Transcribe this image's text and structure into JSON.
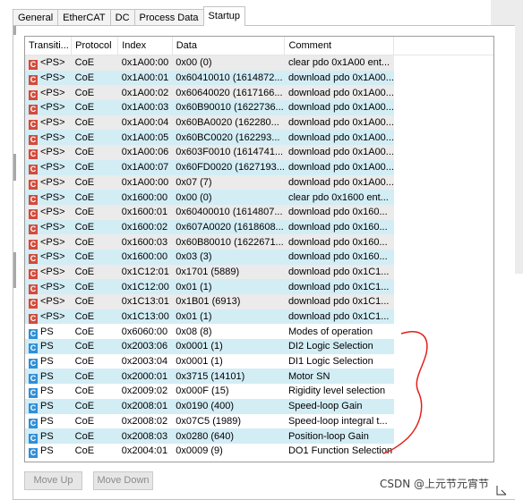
{
  "tabs": [
    {
      "label": "General",
      "active": false
    },
    {
      "label": "EtherCAT",
      "active": false
    },
    {
      "label": "DC",
      "active": false
    },
    {
      "label": "Process Data",
      "active": false
    },
    {
      "label": "Startup",
      "active": true
    }
  ],
  "columns": [
    "Transiti...",
    "Protocol",
    "Index",
    "Data",
    "Comment"
  ],
  "rows": [
    {
      "icon": "C",
      "icon_color": "red",
      "transition": "<PS>",
      "protocol": "CoE",
      "index": "0x1A00:00",
      "data": "0x00 (0)",
      "comment": "clear pdo 0x1A00 ent..."
    },
    {
      "icon": "C",
      "icon_color": "red",
      "transition": "<PS>",
      "protocol": "CoE",
      "index": "0x1A00:01",
      "data": "0x60410010 (1614872...",
      "comment": "download pdo 0x1A00..."
    },
    {
      "icon": "C",
      "icon_color": "red",
      "transition": "<PS>",
      "protocol": "CoE",
      "index": "0x1A00:02",
      "data": "0x60640020 (1617166...",
      "comment": "download pdo 0x1A00..."
    },
    {
      "icon": "C",
      "icon_color": "red",
      "transition": "<PS>",
      "protocol": "CoE",
      "index": "0x1A00:03",
      "data": "0x60B90010 (1622736...",
      "comment": "download pdo 0x1A00..."
    },
    {
      "icon": "C",
      "icon_color": "red",
      "transition": "<PS>",
      "protocol": "CoE",
      "index": "0x1A00:04",
      "data": "0x60BA0020 (162280...",
      "comment": "download pdo 0x1A00..."
    },
    {
      "icon": "C",
      "icon_color": "red",
      "transition": "<PS>",
      "protocol": "CoE",
      "index": "0x1A00:05",
      "data": "0x60BC0020 (162293...",
      "comment": "download pdo 0x1A00..."
    },
    {
      "icon": "C",
      "icon_color": "red",
      "transition": "<PS>",
      "protocol": "CoE",
      "index": "0x1A00:06",
      "data": "0x603F0010 (1614741...",
      "comment": "download pdo 0x1A00..."
    },
    {
      "icon": "C",
      "icon_color": "red",
      "transition": "<PS>",
      "protocol": "CoE",
      "index": "0x1A00:07",
      "data": "0x60FD0020 (1627193...",
      "comment": "download pdo 0x1A00..."
    },
    {
      "icon": "C",
      "icon_color": "red",
      "transition": "<PS>",
      "protocol": "CoE",
      "index": "0x1A00:00",
      "data": "0x07 (7)",
      "comment": "download pdo 0x1A00..."
    },
    {
      "icon": "C",
      "icon_color": "red",
      "transition": "<PS>",
      "protocol": "CoE",
      "index": "0x1600:00",
      "data": "0x00 (0)",
      "comment": "clear pdo 0x1600 ent..."
    },
    {
      "icon": "C",
      "icon_color": "red",
      "transition": "<PS>",
      "protocol": "CoE",
      "index": "0x1600:01",
      "data": "0x60400010 (1614807...",
      "comment": "download pdo 0x160..."
    },
    {
      "icon": "C",
      "icon_color": "red",
      "transition": "<PS>",
      "protocol": "CoE",
      "index": "0x1600:02",
      "data": "0x607A0020 (1618608...",
      "comment": "download pdo 0x160..."
    },
    {
      "icon": "C",
      "icon_color": "red",
      "transition": "<PS>",
      "protocol": "CoE",
      "index": "0x1600:03",
      "data": "0x60B80010 (1622671...",
      "comment": "download pdo 0x160..."
    },
    {
      "icon": "C",
      "icon_color": "red",
      "transition": "<PS>",
      "protocol": "CoE",
      "index": "0x1600:00",
      "data": "0x03 (3)",
      "comment": "download pdo 0x160..."
    },
    {
      "icon": "C",
      "icon_color": "red",
      "transition": "<PS>",
      "protocol": "CoE",
      "index": "0x1C12:01",
      "data": "0x1701 (5889)",
      "comment": "download pdo 0x1C1..."
    },
    {
      "icon": "C",
      "icon_color": "red",
      "transition": "<PS>",
      "protocol": "CoE",
      "index": "0x1C12:00",
      "data": "0x01 (1)",
      "comment": "download pdo 0x1C1..."
    },
    {
      "icon": "C",
      "icon_color": "red",
      "transition": "<PS>",
      "protocol": "CoE",
      "index": "0x1C13:01",
      "data": "0x1B01 (6913)",
      "comment": "download pdo 0x1C1..."
    },
    {
      "icon": "C",
      "icon_color": "red",
      "transition": "<PS>",
      "protocol": "CoE",
      "index": "0x1C13:00",
      "data": "0x01 (1)",
      "comment": "download pdo 0x1C1..."
    },
    {
      "icon": "C",
      "icon_color": "blue",
      "transition": "PS",
      "protocol": "CoE",
      "index": "0x6060:00",
      "data": "0x08 (8)",
      "comment": "Modes of operation"
    },
    {
      "icon": "C",
      "icon_color": "blue",
      "transition": "PS",
      "protocol": "CoE",
      "index": "0x2003:06",
      "data": "0x0001 (1)",
      "comment": "DI2 Logic Selection"
    },
    {
      "icon": "C",
      "icon_color": "blue",
      "transition": "PS",
      "protocol": "CoE",
      "index": "0x2003:04",
      "data": "0x0001 (1)",
      "comment": "DI1 Logic Selection"
    },
    {
      "icon": "C",
      "icon_color": "blue",
      "transition": "PS",
      "protocol": "CoE",
      "index": "0x2000:01",
      "data": "0x3715 (14101)",
      "comment": "Motor SN"
    },
    {
      "icon": "C",
      "icon_color": "blue",
      "transition": "PS",
      "protocol": "CoE",
      "index": "0x2009:02",
      "data": "0x000F (15)",
      "comment": "Rigidity level selection"
    },
    {
      "icon": "C",
      "icon_color": "blue",
      "transition": "PS",
      "protocol": "CoE",
      "index": "0x2008:01",
      "data": "0x0190 (400)",
      "comment": "Speed-loop Gain"
    },
    {
      "icon": "C",
      "icon_color": "blue",
      "transition": "PS",
      "protocol": "CoE",
      "index": "0x2008:02",
      "data": "0x07C5 (1989)",
      "comment": "Speed-loop integral t..."
    },
    {
      "icon": "C",
      "icon_color": "blue",
      "transition": "PS",
      "protocol": "CoE",
      "index": "0x2008:03",
      "data": "0x0280 (640)",
      "comment": "Position-loop Gain"
    },
    {
      "icon": "C",
      "icon_color": "blue",
      "transition": "PS",
      "protocol": "CoE",
      "index": "0x2004:01",
      "data": "0x0009 (9)",
      "comment": "DO1 Function Selection"
    }
  ],
  "buttons": {
    "move_up": "Move Up",
    "move_down": "Move Down"
  },
  "watermark": "CSDN @上元节元宵节",
  "colors": {
    "red_icon": "#d24b3c",
    "blue_icon": "#2f8fd8",
    "annotation": "#e0201a",
    "row_blue": "#d3edf5",
    "row_gray": "#ebebeb"
  }
}
